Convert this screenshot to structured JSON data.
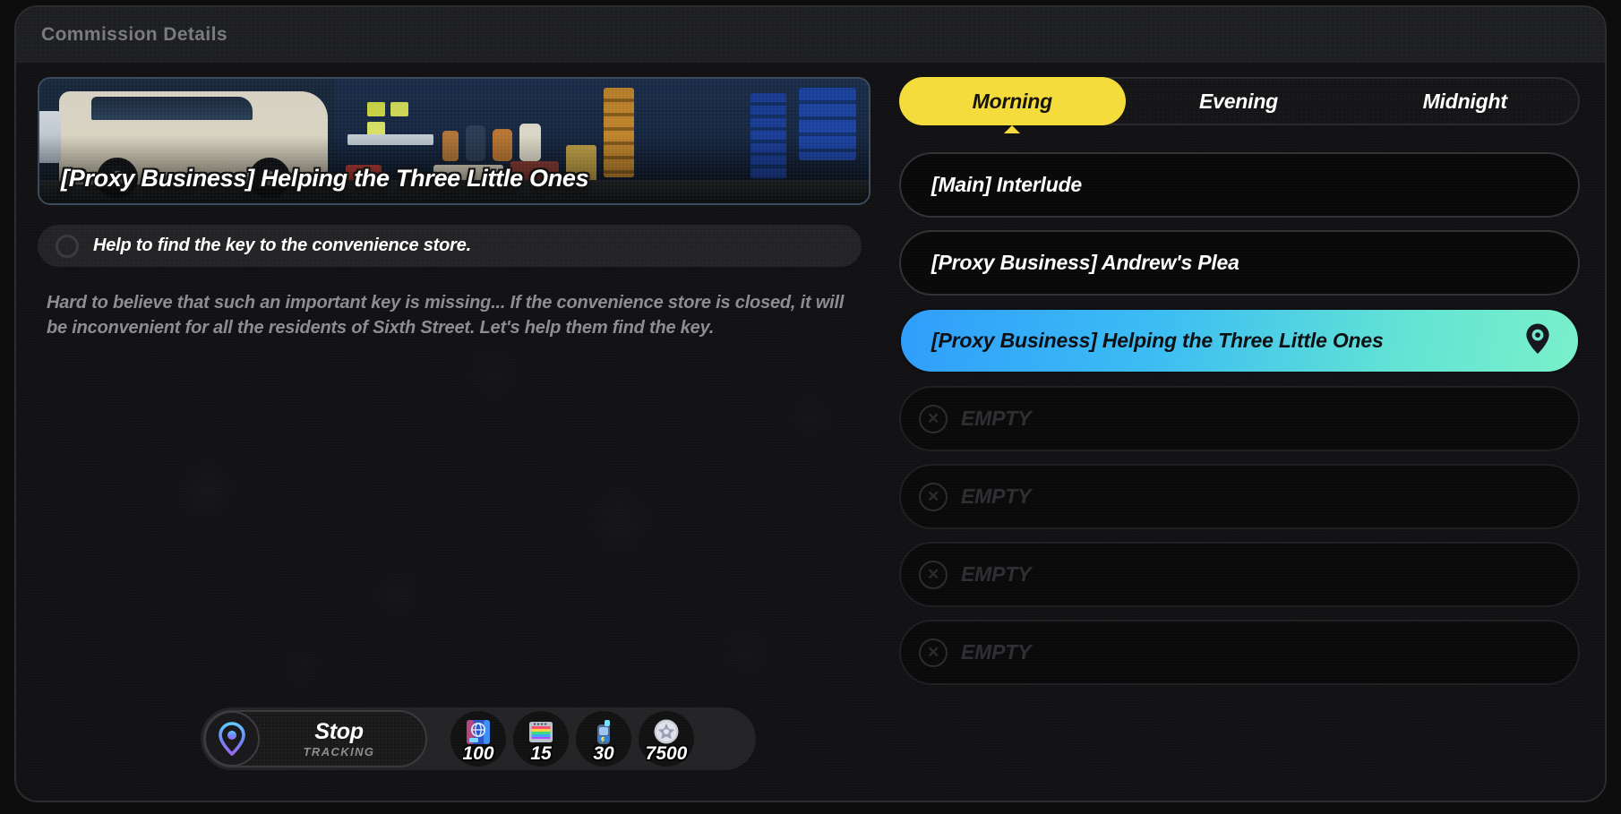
{
  "window": {
    "title": "Commission Details"
  },
  "commission": {
    "banner_title": "[Proxy Business] Helping the Three Little Ones",
    "banner_scene_alt": "convenience-store-night-scene-with-van",
    "objective": {
      "text": "Help to find the key to the convenience store.",
      "checkbox_state": "unchecked"
    },
    "description": "Hard to believe that such an important key is missing... If the convenience store is closed, it will be inconvenient for all the residents of Sixth Street. Let's help them find the key."
  },
  "tracking": {
    "action_label": "Stop",
    "sub_label": "TRACKING",
    "pin_icon": "location-pin-icon"
  },
  "rewards": [
    {
      "icon": "blue-book-globe-icon",
      "count": "100"
    },
    {
      "icon": "colorful-film-tape-icon",
      "count": "15"
    },
    {
      "icon": "blue-canister-icon",
      "count": "30"
    },
    {
      "icon": "silver-star-coin-icon",
      "count": "7500"
    }
  ],
  "time_tabs": [
    {
      "label": "Morning",
      "active": true
    },
    {
      "label": "Evening",
      "active": false
    },
    {
      "label": "Midnight",
      "active": false
    }
  ],
  "missions": [
    {
      "label": "[Main] Interlude",
      "state": "available",
      "selected": false
    },
    {
      "label": "[Proxy Business] Andrew's Plea",
      "state": "available",
      "selected": false
    },
    {
      "label": "[Proxy Business] Helping the Three Little Ones",
      "state": "available",
      "selected": true,
      "pin_icon": "location-pin-icon"
    },
    {
      "label": "EMPTY",
      "state": "empty",
      "selected": false,
      "icon": "x-circle-icon"
    },
    {
      "label": "EMPTY",
      "state": "empty",
      "selected": false,
      "icon": "x-circle-icon"
    },
    {
      "label": "EMPTY",
      "state": "empty",
      "selected": false,
      "icon": "x-circle-icon"
    },
    {
      "label": "EMPTY",
      "state": "empty",
      "selected": false,
      "icon": "x-circle-icon"
    }
  ],
  "colors": {
    "tab_active": "#f5dc3d",
    "selected_gradient_start": "#2f9dfb",
    "selected_gradient_end": "#79f0c9",
    "panel_bg": "#111113",
    "window_bg": "#161618"
  }
}
